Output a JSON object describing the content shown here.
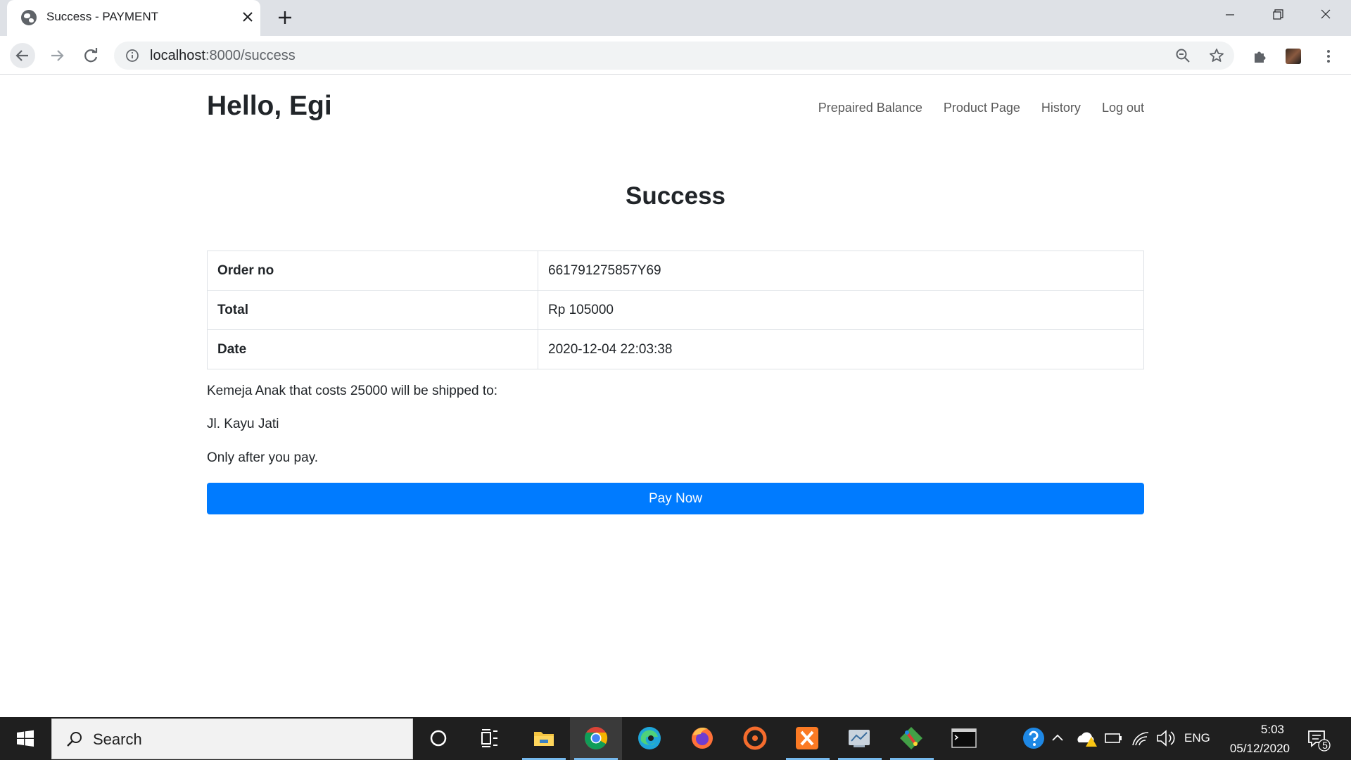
{
  "browser": {
    "tab_title": "Success - PAYMENT",
    "url_host": "localhost",
    "url_rest": ":8000/success"
  },
  "page": {
    "brand": "Hello, Egi",
    "nav": [
      "Prepaired Balance",
      "Product Page",
      "History",
      "Log out"
    ],
    "heading": "Success",
    "details": [
      {
        "label": "Order no",
        "value": "661791275857Y69"
      },
      {
        "label": "Total",
        "value": "Rp 105000"
      },
      {
        "label": "Date",
        "value": "2020-12-04 22:03:38"
      }
    ],
    "shipping_text": "Kemeja Anak that costs 25000 will be shipped to:",
    "address": "Jl. Kayu Jati",
    "note": "Only after you pay.",
    "pay_button": "Pay Now",
    "accent": "#007bff"
  },
  "taskbar": {
    "search_label": "Search",
    "language": "ENG",
    "time": "5:03",
    "date": "05/12/2020",
    "notification_count": "5",
    "apps": [
      "cortana-icon",
      "task-view-icon",
      "file-explorer-icon",
      "chrome-icon",
      "edge-icon",
      "firefox-icon",
      "origin-icon",
      "xampp-icon",
      "app-icon",
      "git-icon",
      "terminal-icon"
    ]
  }
}
